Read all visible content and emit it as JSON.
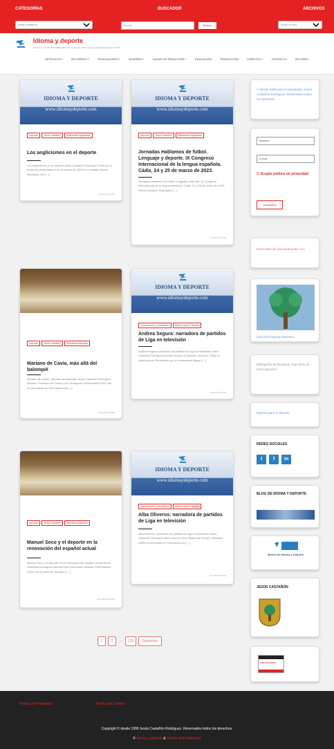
{
  "topbar": {
    "categories_label": "CATEGORÍAS",
    "categories_select": "Elegir categoría",
    "search_label": "BUSCADOR",
    "search_placeholder": "Buscar ...",
    "search_button": "Buscar",
    "archives_label": "ARCHIVOS",
    "archives_select": "Elegir el mes"
  },
  "header": {
    "site_title": "Idioma y deporte",
    "tagline": "Número 3+ 13.08. ISSN 1886-5461 Ciclo 1 Julio de 2023. Número actualizado agosto de 2023",
    "nav": [
      "ARTÍCULOS ˅",
      "RECURSOS ˅",
      "EDUCACIONES ˅",
      "RESEÑAS ˅",
      "DUDAS DE REDACCIÓN ˅",
      "EDUCACIÓN",
      "TRADUCCIÓN",
      "CRÉDITOS ˅",
      "CONTACTO",
      "AUTORES"
    ]
  },
  "banner": {
    "title": "IDIOMA Y DEPORTE",
    "url": "www.idiomaydeporte.com"
  },
  "posts": [
    {
      "tags": [
        "Artículos",
        "Jesús Castañón",
        "Reflexiones lingüísticas"
      ],
      "title": "Los anglicismos en el deporte",
      "excerpt": "Los anglicismos en el deporte Jesús Castañón Rodríguez Texto de la ponencia presentada el 24 de marzo de 2023 en el estadio Nuevo Mirandilla, del […]",
      "date": "6 de abril de 2023"
    },
    {
      "tags": [
        "Artículos",
        "Jesús Castañón",
        "Reflexiones lingüísticas"
      ],
      "title": "Jornadas Hablamos de fútbol. Lenguaje y deporte. IX Congreso Internacional de la lengua española. Cádiz, 24 y 25 de marzo de 2023.",
      "excerpt": "Jornadas Hablamos de fútbol. Lenguaje y deporte. IX Congreso Internacional de la lengua española. Cádiz, 24 y 25 de marzo de 2023. Jesús Castañón Rodríguez […]",
      "date": "1 de abril de 2023"
    },
    {
      "tags": [
        "Artículos",
        "Jesús Castañón",
        "Periodismo deportivo"
      ],
      "title": "Mariano de Cavia, más allá del balompié",
      "excerpt": "Mariano de Cavia, más allá del balompié Jesús Castañón Rodríguez Mariano Francisco de Cavia y Lac (Zaragoza, 1855-Madrid 1920) fue un periodista con una trayectoria […]",
      "date": "5 de julio de 2022"
    },
    {
      "tags": [
        "Comunicación y periodismo",
        "Mujeres para el deporte"
      ],
      "title": "Andrea Segura: narradora de partidos de Liga en televisión",
      "excerpt": "Andrea Segura: narradora de partidos de Liga en televisión Jesús Castañón Rodríguez Andrea Segura (Campello, Alicante, 1994) es licenciada en Periodismo por la Universidad Miguel […]",
      "date": "5 de julio de 2022"
    },
    {
      "tags": [
        "Artículos",
        "Jesús Castañón",
        "Periodismo deportivo"
      ],
      "title": "Manuel Seco y el deporte en la renovación del español actual",
      "excerpt": "Manuel Seco y el deporte en la renovación del español actual Jesús Castañón Rodríguez Manuel Seco Reymundo (Madrid, 1928-Madrid, 2021) fue un profesor, filólogo y […]",
      "date": "5 de mayo de 2021"
    },
    {
      "tags": [
        "Comunicación y periodismo",
        "Mujeres para el deporte"
      ],
      "title": "Alba Oliveros: narradora de partidos de Liga en televisión",
      "excerpt": "Alba Oliveros: narradora de partidos de Liga en televisión Jesús Castañón Rodríguez Alba Oliveros (San Miguel del Arroyo, Valladolid, 1995) es licenciada en Periodismo por […]",
      "date": "5 de abril de 2021"
    }
  ],
  "sidebar": {
    "copyright": "© Desde 1999 para la actualidad. Jesús Castañón Rodríguez. Reservados todos los derechos.",
    "name_field": "Nombre",
    "email_field": "E-mail",
    "privacy": "☐ Acepto política de privacidad",
    "subscribe": "Suscribirse",
    "specials": "Especiales de idiomaydeporte.com",
    "guide_label": "Guía del lenguaje deportivo",
    "bibliography": "Bibliografía de literatura, especifida de tema deportivo",
    "women": "Mujeres para el deporte",
    "social_head": "REDES SOCIALES",
    "social": [
      "t",
      "f",
      "in"
    ],
    "blog_head": "BLOG DE IDIOMA Y DEPORTE",
    "museum_label": "Museo de Idioma y Deporte",
    "castanon_head": "JESÚS CASTAÑÓN",
    "badge_label": "Sello de calidad"
  },
  "pagination": [
    "1",
    "2",
    "…",
    "123",
    "Siguientes"
  ],
  "footer": {
    "privacy": "Política de Privacidad",
    "cookies": "Política de Cookies",
    "copyright": "Copyright © desde 1999 Jesús Castañón Rodríguez. Reservados todos los derechos.",
    "credit_prefix": "©",
    "credit_site": "Idioma y deporte",
    "credit_amp": "&",
    "credit_design": "Diseño Web Valladolid"
  },
  "colors": {
    "accent": "#e52222",
    "link": "#6b9ad1",
    "social": "#2a7fc2",
    "footer": "#222222"
  }
}
